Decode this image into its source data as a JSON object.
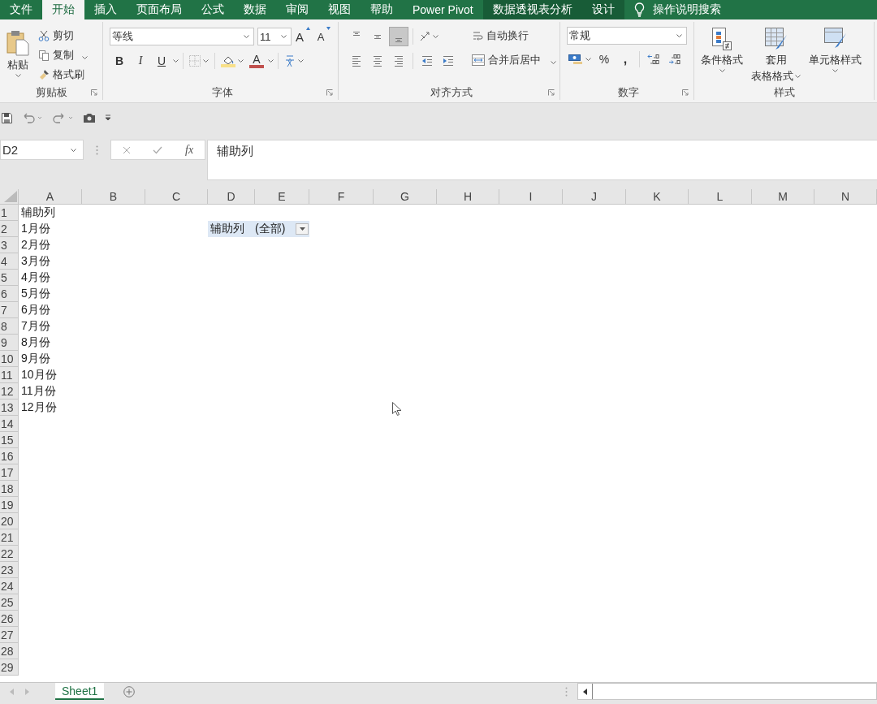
{
  "tabs": [
    {
      "label": "文件",
      "kind": "normal",
      "selected": false
    },
    {
      "label": "开始",
      "kind": "normal",
      "selected": true
    },
    {
      "label": "插入",
      "kind": "normal",
      "selected": false
    },
    {
      "label": "页面布局",
      "kind": "normal",
      "selected": false
    },
    {
      "label": "公式",
      "kind": "normal",
      "selected": false
    },
    {
      "label": "数据",
      "kind": "normal",
      "selected": false
    },
    {
      "label": "审阅",
      "kind": "normal",
      "selected": false
    },
    {
      "label": "视图",
      "kind": "normal",
      "selected": false
    },
    {
      "label": "帮助",
      "kind": "normal",
      "selected": false
    },
    {
      "label": "Power Pivot",
      "kind": "normal",
      "selected": false
    },
    {
      "label": "数据透视表分析",
      "kind": "contextual",
      "selected": false
    },
    {
      "label": "设计",
      "kind": "contextual",
      "selected": false
    }
  ],
  "tell_me": {
    "label": "操作说明搜索"
  },
  "ribbon": {
    "clipboard": {
      "title": "剪贴板",
      "paste": "粘贴",
      "cut": "剪切",
      "copy": "复制",
      "format_painter": "格式刷"
    },
    "font": {
      "title": "字体",
      "font_name": "等线",
      "font_size": "11",
      "grow": "A",
      "shrink": "A",
      "bold": "B",
      "italic": "I",
      "underline": "U",
      "font_color": "A"
    },
    "alignment": {
      "title": "对齐方式",
      "align_buttons": [
        {
          "kind": "top",
          "selected": false
        },
        {
          "kind": "middle",
          "selected": false
        },
        {
          "kind": "bottom",
          "selected": true
        },
        {
          "kind": "left",
          "selected": false
        },
        {
          "kind": "center",
          "selected": false
        },
        {
          "kind": "right",
          "selected": false
        }
      ],
      "wrap_text": "自动换行",
      "merge_center": "合并后居中"
    },
    "number": {
      "title": "数字",
      "format": "常规",
      "percent": "%",
      "comma": ","
    },
    "styles": {
      "title": "样式",
      "buttons": [
        {
          "kind": "conditional",
          "lines": [
            "条件格式"
          ]
        },
        {
          "kind": "table",
          "lines": [
            "套用",
            "表格格式"
          ]
        },
        {
          "kind": "cell",
          "lines": [
            "单元格样式"
          ]
        }
      ]
    }
  },
  "formula_bar": {
    "name_box": "D2",
    "function_label": "fx",
    "formula": "辅助列"
  },
  "sheet": {
    "columns": [
      "A",
      "B",
      "C",
      "D",
      "E",
      "F",
      "G",
      "H",
      "I",
      "J",
      "K",
      "L",
      "M",
      "N"
    ],
    "rows": [
      {
        "header": "1",
        "cells": [
          {
            "kind": "plain",
            "text": "辅助列"
          }
        ]
      },
      {
        "header": "2",
        "cells": [
          {
            "kind": "plain",
            "text": "1月份"
          },
          {
            "text": ""
          },
          {
            "text": ""
          },
          {
            "kind": "pivot-label",
            "text": "辅助列"
          },
          {
            "kind": "pivot-filter",
            "text": "(全部)"
          }
        ]
      },
      {
        "header": "3",
        "cells": [
          {
            "kind": "plain",
            "text": "2月份"
          }
        ]
      },
      {
        "header": "4",
        "cells": [
          {
            "kind": "plain",
            "text": "3月份"
          }
        ]
      },
      {
        "header": "5",
        "cells": [
          {
            "kind": "plain",
            "text": "4月份"
          }
        ]
      },
      {
        "header": "6",
        "cells": [
          {
            "kind": "plain",
            "text": "5月份"
          }
        ]
      },
      {
        "header": "7",
        "cells": [
          {
            "kind": "plain",
            "text": "6月份"
          }
        ]
      },
      {
        "header": "8",
        "cells": [
          {
            "kind": "plain",
            "text": "7月份"
          }
        ]
      },
      {
        "header": "9",
        "cells": [
          {
            "kind": "plain",
            "text": "8月份"
          }
        ]
      },
      {
        "header": "10",
        "cells": [
          {
            "kind": "plain",
            "text": "9月份"
          }
        ]
      },
      {
        "header": "11",
        "cells": [
          {
            "kind": "plain",
            "text": "10月份"
          }
        ]
      },
      {
        "header": "12",
        "cells": [
          {
            "kind": "plain",
            "text": "11月份"
          }
        ]
      },
      {
        "header": "13",
        "cells": [
          {
            "kind": "plain",
            "text": "12月份"
          }
        ]
      },
      {
        "header": "14",
        "cells": []
      },
      {
        "header": "15",
        "cells": []
      },
      {
        "header": "16",
        "cells": []
      },
      {
        "header": "17",
        "cells": []
      },
      {
        "header": "18",
        "cells": []
      },
      {
        "header": "19",
        "cells": []
      },
      {
        "header": "20",
        "cells": []
      },
      {
        "header": "21",
        "cells": []
      },
      {
        "header": "22",
        "cells": []
      },
      {
        "header": "23",
        "cells": []
      },
      {
        "header": "24",
        "cells": []
      },
      {
        "header": "25",
        "cells": []
      },
      {
        "header": "26",
        "cells": []
      },
      {
        "header": "27",
        "cells": []
      },
      {
        "header": "28",
        "cells": []
      },
      {
        "header": "29",
        "cells": []
      }
    ]
  },
  "sheet_tabs": [
    {
      "name": "Sheet1",
      "selected": true
    }
  ]
}
